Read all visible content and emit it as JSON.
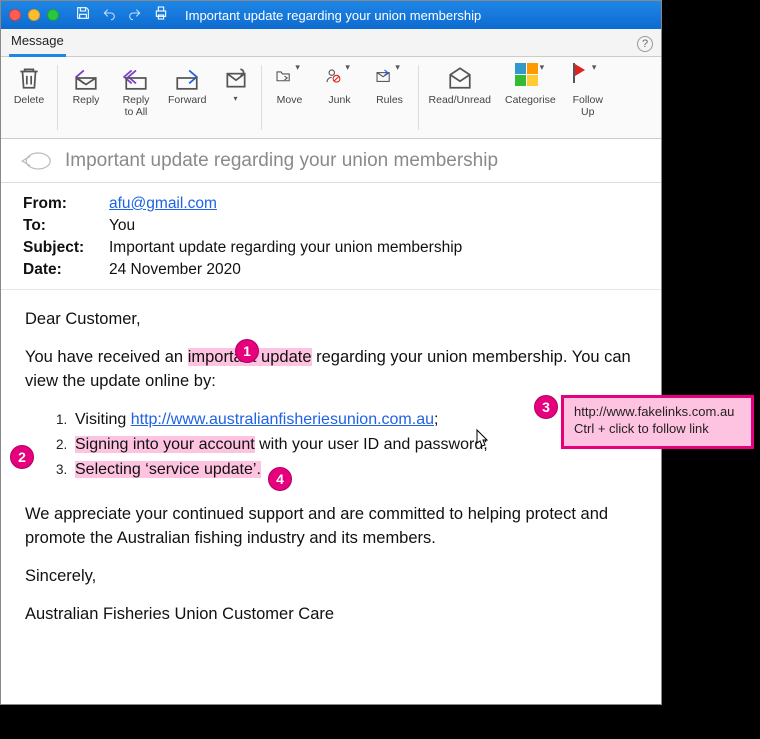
{
  "window": {
    "title": "Important update regarding your union membership"
  },
  "tabs": {
    "message": "Message"
  },
  "ribbon": {
    "delete": "Delete",
    "reply": "Reply",
    "replyAll": "Reply\nto All",
    "forward": "Forward",
    "move": "Move",
    "junk": "Junk",
    "rules": "Rules",
    "readUnread": "Read/Unread",
    "categorise": "Categorise",
    "followUp": "Follow\nUp"
  },
  "subjectBar": "Important update regarding your union membership",
  "headers": {
    "fromLabel": "From:",
    "from": "afu@gmail.com",
    "toLabel": "To:",
    "to": "You",
    "subjectLabel": "Subject:",
    "subject": "Important update regarding your union membership",
    "dateLabel": "Date:",
    "date": "24 November 2020"
  },
  "body": {
    "greeting": "Dear Customer,",
    "p1a": "You have received an ",
    "p1hl": "important update",
    "p1b": " regarding your union membership. You can view the update online by:",
    "l1a": "Visiting ",
    "l1link": "http://www.australianfisheriesunion.com.au",
    "l1b": ";",
    "l2hl": "Signing into your account",
    "l2b": " with your user ID and password;",
    "l3hl": "Selecting ‘service update’.",
    "p2": "We appreciate your continued support and are committed to helping protect and promote the Australian fishing industry and its members.",
    "sig1": "Sincerely,",
    "sig2": "Australian Fisheries Union Customer Care"
  },
  "tooltip": {
    "url": "http://www.fakelinks.com.au",
    "hint": "Ctrl + click to follow link"
  },
  "callouts": {
    "c1": "1",
    "c2": "2",
    "c3": "3",
    "c4": "4"
  }
}
